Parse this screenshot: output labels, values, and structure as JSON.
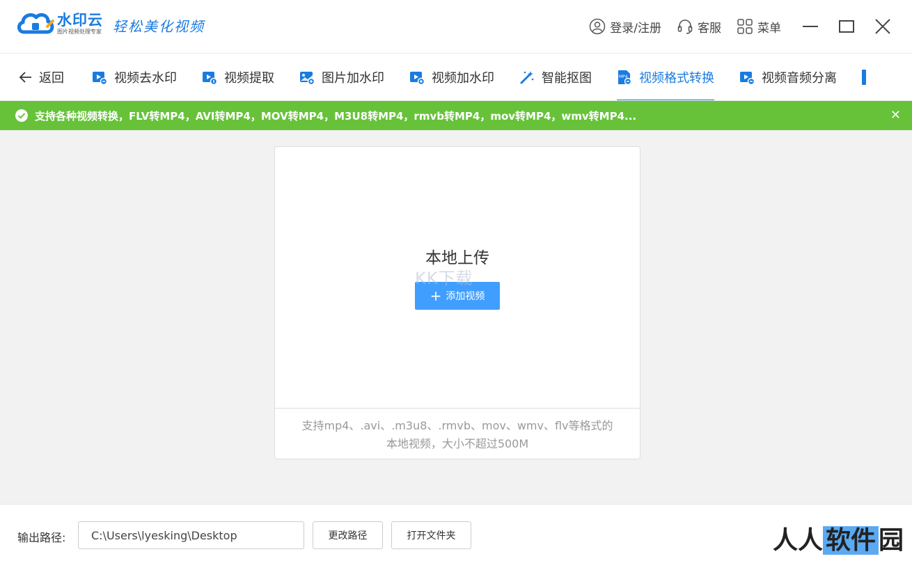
{
  "app": {
    "name": "水印云",
    "subtitle": "图片视频处理专家",
    "slogan": "轻松美化视频",
    "brand_color": "#1a7be0"
  },
  "titlebar": {
    "login_label": "登录/注册",
    "service_label": "客服",
    "menu_label": "菜单"
  },
  "nav": {
    "back_label": "返回",
    "tabs": [
      {
        "label": "视频去水印",
        "icon": "video-icon"
      },
      {
        "label": "视频提取",
        "icon": "video-icon"
      },
      {
        "label": "图片加水印",
        "icon": "image-icon"
      },
      {
        "label": "视频加水印",
        "icon": "video-icon"
      },
      {
        "label": "智能抠图",
        "icon": "magic-wand-icon"
      },
      {
        "label": "视频格式转换",
        "icon": "mp4-file-icon",
        "active": true
      },
      {
        "label": "视频音频分离",
        "icon": "video-icon"
      }
    ]
  },
  "notice": {
    "text": "支持各种视频转换，FLV转MP4，AVI转MP4，MOV转MP4，M3U8转MP4，rmvb转MP4，mov转MP4，wmv转MP4...",
    "color": "#67c23a"
  },
  "upload": {
    "title": "本地上传",
    "button_label": "添加视频",
    "hint_line1": "支持mp4、.avi、.m3u8、.rmvb、mov、wmv、flv等格式的",
    "hint_line2": "本地视频，大小不超过500M"
  },
  "watermark": {
    "text": "KK下载"
  },
  "output": {
    "label": "输出路径:",
    "path": "C:\\Users\\lyesking\\Desktop",
    "change_label": "更改路径",
    "open_label": "打开文件夹"
  },
  "corner_watermark": {
    "part1": "人人",
    "part2": "软件",
    "part3": "园"
  }
}
